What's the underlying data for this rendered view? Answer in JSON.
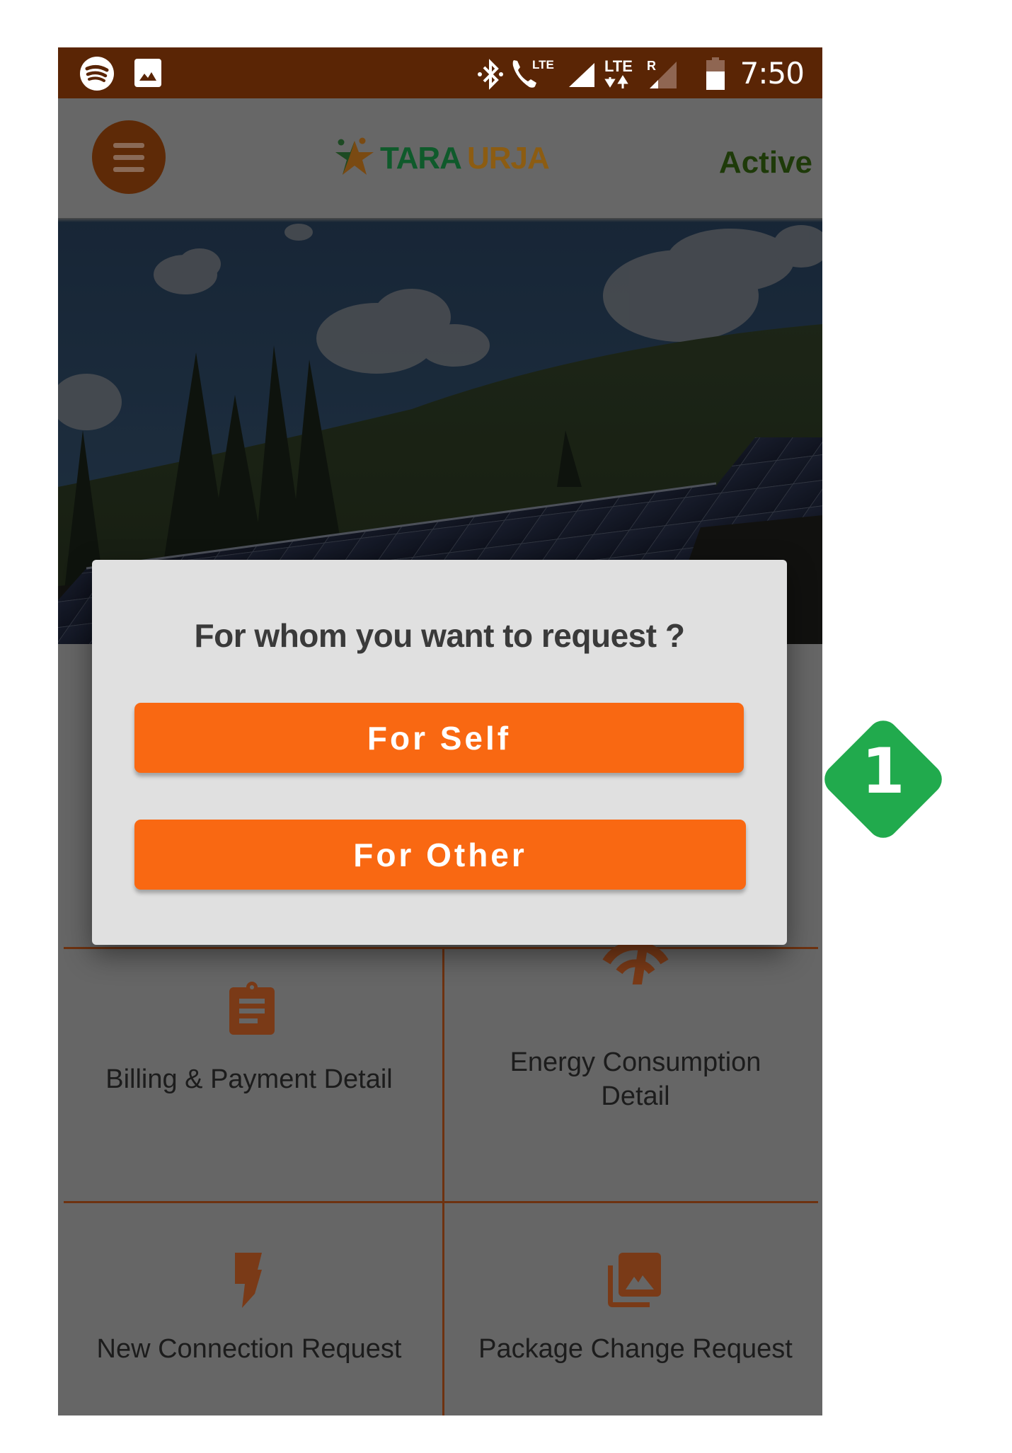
{
  "status_bar": {
    "left_icons": [
      "spotify-icon",
      "image-notification-icon"
    ],
    "right_icons": [
      "bluetooth-icon",
      "volte-call-icon",
      "signal-icon",
      "lte-data-icon",
      "roaming-signal-icon",
      "battery-icon"
    ],
    "volte_label": "LTE",
    "lte_label": "LTE",
    "roaming_label": "R",
    "time": "7:50"
  },
  "app_bar": {
    "menu_icon": "hamburger-menu-icon",
    "logo": {
      "word1": "TARA",
      "word2": "URJA"
    },
    "status": "Active",
    "colors": {
      "status_bar": "#5a2505",
      "logo_green": "#0f5a2b",
      "logo_orange": "#8c5c12"
    }
  },
  "banner": {
    "description": "Solar panels in a field with trees and hills"
  },
  "menu_tiles": [
    {
      "label": "Billing & Payment Detail",
      "icon": "clipboard-icon"
    },
    {
      "label_line1": "Energy Consumption",
      "label_line2": "Detail",
      "icon": "gauge-icon"
    },
    {
      "label": "New Connection Request",
      "icon": "lightning-bolt-icon"
    },
    {
      "label": "Package Change Request",
      "icon": "photo-library-icon"
    }
  ],
  "dialog": {
    "title": "For whom you want to request ?",
    "buttons": [
      {
        "label": "For Self"
      },
      {
        "label": "For Other"
      }
    ],
    "accent_color": "#f96812"
  },
  "annotation": {
    "number": "1",
    "color": "#21aa4d"
  }
}
